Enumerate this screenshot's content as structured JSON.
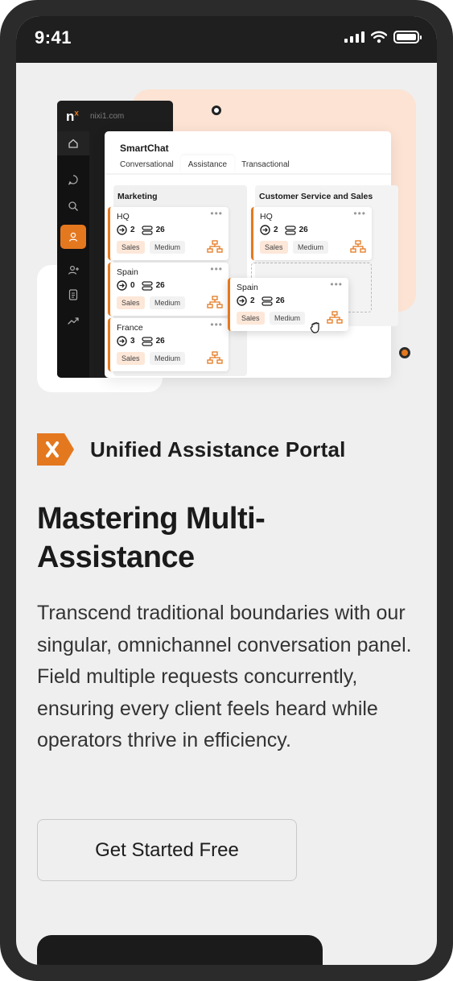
{
  "status_bar": {
    "time": "9:41"
  },
  "app": {
    "logo": "n",
    "logo_sup": "x",
    "domain": "nixi1.com",
    "panel_title": "SmartChat",
    "tabs": [
      {
        "label": "Conversational",
        "active": false
      },
      {
        "label": "Assistance",
        "active": true
      },
      {
        "label": "Transactional",
        "active": false
      }
    ],
    "columns": [
      {
        "title": "Marketing",
        "cards": [
          {
            "name": "HQ",
            "incoming": "2",
            "queue": "26",
            "tag1": "Sales",
            "tag2": "Medium"
          },
          {
            "name": "Spain",
            "incoming": "0",
            "queue": "26",
            "tag1": "Sales",
            "tag2": "Medium"
          },
          {
            "name": "France",
            "incoming": "3",
            "queue": "26",
            "tag1": "Sales",
            "tag2": "Medium"
          }
        ]
      },
      {
        "title": "Customer Service and Sales",
        "cards": [
          {
            "name": "HQ",
            "incoming": "2",
            "queue": "26",
            "tag1": "Sales",
            "tag2": "Medium"
          }
        ]
      }
    ],
    "dragging_card": {
      "name": "Spain",
      "incoming": "2",
      "queue": "26",
      "tag1": "Sales",
      "tag2": "Medium"
    },
    "accent_color": "#e4781f"
  },
  "content": {
    "badge_label": "Unified Assistance Portal",
    "headline": "Mastering Multi-Assistance",
    "body": "Transcend traditional boundaries with our singular, omnichannel conversation panel. Field multiple requests concurrently, ensuring every client feels heard while operators thrive in efficiency.",
    "cta_label": "Get Started Free"
  }
}
